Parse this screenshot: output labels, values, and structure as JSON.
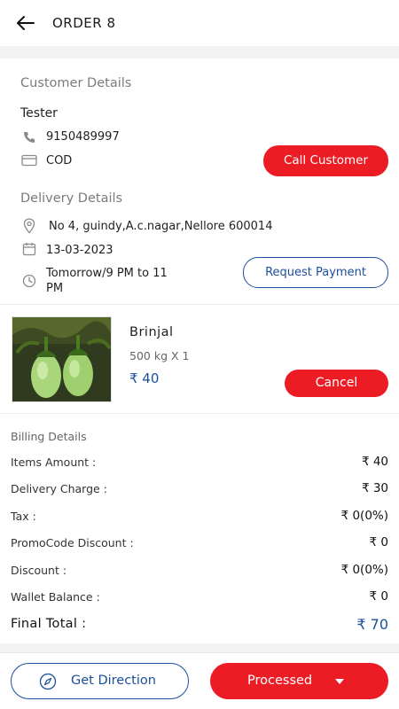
{
  "header": {
    "title": "ORDER 8"
  },
  "customer": {
    "section_label": "Customer Details",
    "name": "Tester",
    "phone": "9150489997",
    "payment": "COD",
    "call_label": "Call Customer"
  },
  "delivery": {
    "section_label": "Delivery Details",
    "address": "No 4, guindy,A.c.nagar,Nellore 600014",
    "date": "13-03-2023",
    "slot_line1": "Tomorrow/9 PM to 11",
    "slot_line2": "PM",
    "request_label": "Request Payment"
  },
  "product": {
    "name": "Brinjal",
    "quantity": "500 kg X 1",
    "price": "₹ 40",
    "cancel_label": "Cancel"
  },
  "billing": {
    "section_label": "Billing Details",
    "rows": [
      {
        "label": "Items Amount :",
        "value": "₹ 40"
      },
      {
        "label": "Delivery Charge :",
        "value": "₹ 30"
      },
      {
        "label": "Tax :",
        "value": "₹ 0(0%)"
      },
      {
        "label": "PromoCode Discount :",
        "value": "₹ 0"
      },
      {
        "label": "Discount :",
        "value": "₹ 0(0%)"
      },
      {
        "label": "Wallet Balance :",
        "value": "₹ 0"
      }
    ],
    "final_label": "Final Total :",
    "final_value": "₹ 70"
  },
  "footer": {
    "direction_label": "Get Direction",
    "status_label": "Processed"
  },
  "colors": {
    "accent": "#ec1c24",
    "link": "#1b4f9c"
  }
}
